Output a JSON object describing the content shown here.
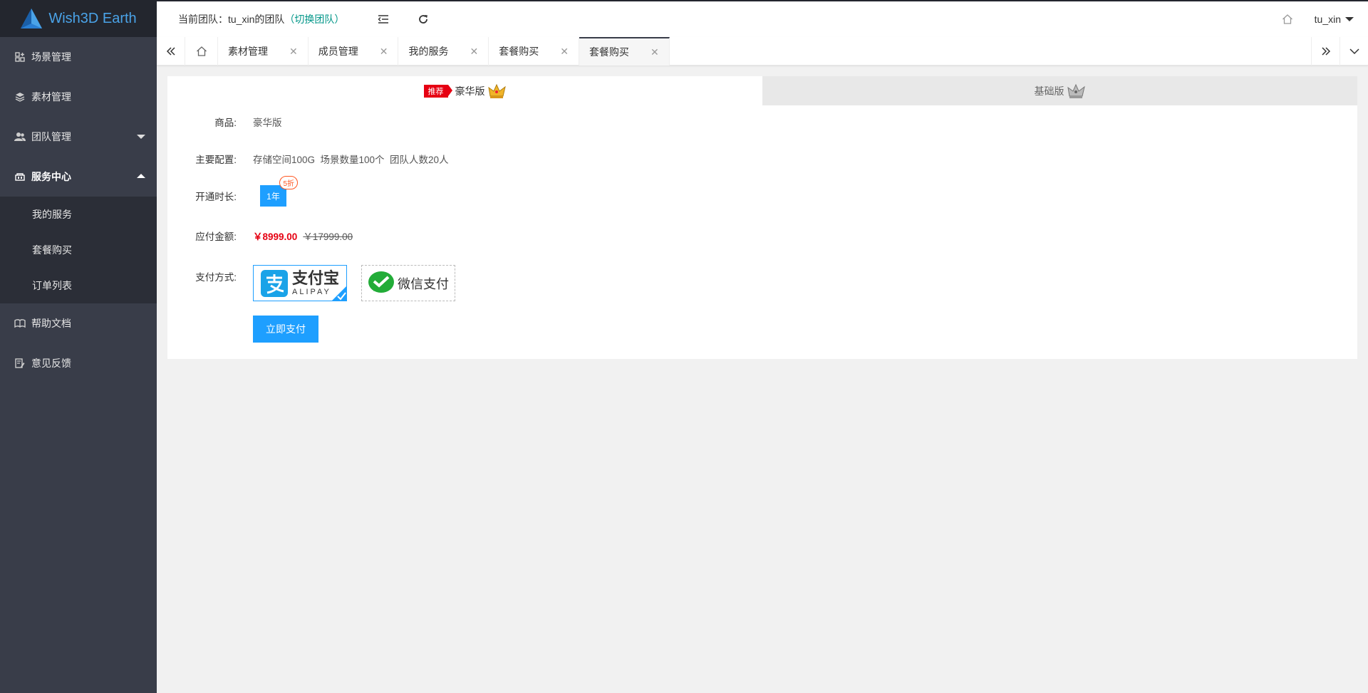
{
  "app": {
    "name": "Wish3D Earth"
  },
  "header": {
    "team_prefix": "当前团队：",
    "team_name": "tu_xin的团队",
    "team_switch": "（切换团队）",
    "user": "tu_xin"
  },
  "sidebar": {
    "items": [
      {
        "label": "场景管理",
        "icon": "scene-icon"
      },
      {
        "label": "素材管理",
        "icon": "layers-icon"
      },
      {
        "label": "团队管理",
        "icon": "team-icon"
      },
      {
        "label": "服务中心",
        "icon": "service-icon"
      },
      {
        "label": "帮助文档",
        "icon": "book-icon"
      },
      {
        "label": "意见反馈",
        "icon": "feedback-icon"
      }
    ],
    "subitems": [
      "我的服务",
      "套餐购买",
      "订单列表"
    ]
  },
  "tabs": [
    {
      "label": "素材管理"
    },
    {
      "label": "成员管理"
    },
    {
      "label": "我的服务"
    },
    {
      "label": "套餐购买"
    },
    {
      "label": "套餐购买",
      "active": true
    }
  ],
  "package_tabs": {
    "recommend_tag": "推荐",
    "deluxe": "豪华版",
    "basic": "基础版"
  },
  "form": {
    "product_label": "商品:",
    "product_value": "豪华版",
    "config_label": "主要配置:",
    "config_value": "存储空间100G  场景数量100个  团队人数20人",
    "duration_label": "开通时长:",
    "duration_value": "1年",
    "duration_discount": "5折",
    "amount_label": "应付金额:",
    "amount_now": "￥8999.00",
    "amount_old": "￥17999.00",
    "payment_label": "支付方式:",
    "alipay_cn": "支付宝",
    "alipay_en": "ALIPAY",
    "wechat": "微信支付",
    "pay_button": "立即支付"
  },
  "colors": {
    "accent": "#1e9fff",
    "sidebar": "#393d49",
    "price": "#e60012"
  }
}
